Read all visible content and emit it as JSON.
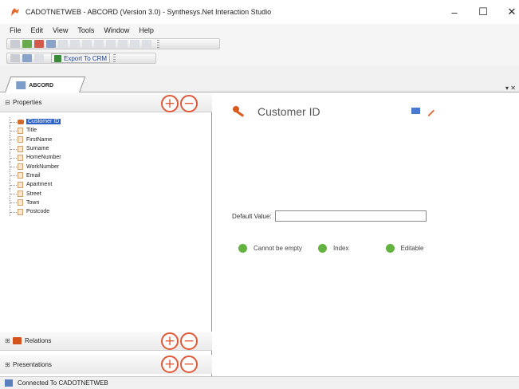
{
  "window": {
    "title": "CADOTNETWEB - ABCORD (Version 3.0) - Synthesys.Net Interaction Studio",
    "controls": {
      "minimize": "–",
      "maximize": "☐",
      "close": "✕"
    }
  },
  "menu": [
    "File",
    "Edit",
    "View",
    "Tools",
    "Window",
    "Help"
  ],
  "toolbar": {
    "export_label": "Export To CRM"
  },
  "document_tab": {
    "label": "ABCORD"
  },
  "left": {
    "properties": {
      "label": "Properties",
      "items": [
        "Customer ID",
        "Title",
        "FirstName",
        "Surname",
        "HomeNumber",
        "WorkNumber",
        "Email",
        "Apartment",
        "Street",
        "Town",
        "Postcode"
      ],
      "selected": "Customer ID"
    },
    "relations": {
      "label": "Relations"
    },
    "presentations": {
      "label": "Presentations"
    },
    "add_symbol": "+",
    "remove_symbol": "−"
  },
  "right": {
    "field_name": "Customer ID",
    "default_value_label": "Default Value:",
    "default_value": "",
    "flags": [
      "Cannot be empty",
      "Index",
      "Editable"
    ]
  },
  "status": {
    "text": "Connected To CADOTNETWEB"
  },
  "colors": {
    "accent_orange": "#e05a3a",
    "flag_green": "#62b340",
    "selection_blue": "#2a63c8"
  }
}
